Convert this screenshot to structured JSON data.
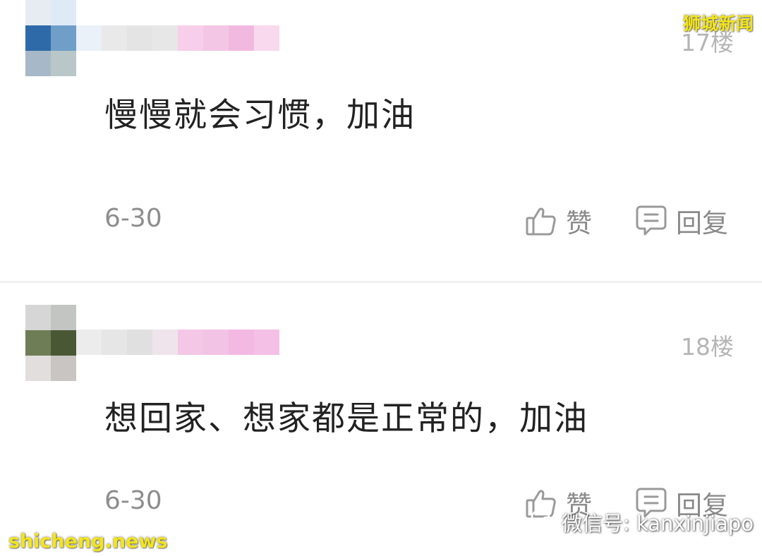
{
  "brand": {
    "top_badge": "狮城新闻",
    "bottom_left": "shicheng.news",
    "wechat_label": "微信号: kanxinjiapo"
  },
  "comments": [
    {
      "floor": "17楼",
      "text": "慢慢就会习惯，加油",
      "date": "6-30",
      "like_label": "赞",
      "reply_label": "回复"
    },
    {
      "floor": "18楼",
      "text": "想回家、想家都是正常的，加油",
      "date": "6-30",
      "like_label": "赞",
      "reply_label": "回复"
    }
  ],
  "colors": {
    "comment_text": "#222222",
    "meta_text": "#8d8d8d",
    "floor_text": "#b5b5b5",
    "watermark_yellow": "#f3e51a",
    "divider": "#f1f1f1"
  },
  "icons": [
    "thumbs-up-icon",
    "comment-bubble-icon",
    "wechat-icon"
  ]
}
